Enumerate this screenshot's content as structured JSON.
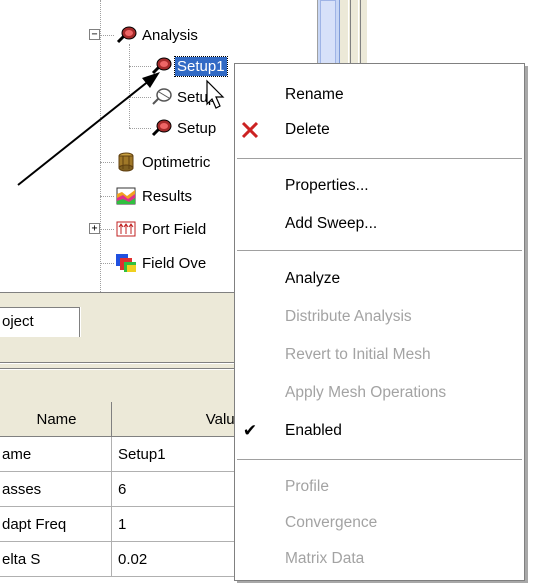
{
  "tree": {
    "nodes": [
      {
        "label": "Analysis",
        "icon": "analysis-icon"
      },
      {
        "label": "Setup1",
        "icon": "setup-icon",
        "selected": true
      },
      {
        "label": "Setup",
        "icon": "setup-disabled-icon"
      },
      {
        "label": "Setup",
        "icon": "setup-icon"
      },
      {
        "label": "Optimetric",
        "icon": "optimetrics-icon"
      },
      {
        "label": "Results",
        "icon": "results-icon"
      },
      {
        "label": "Port Field",
        "icon": "port-field-icon"
      },
      {
        "label": "Field Ove",
        "icon": "field-overlays-icon"
      }
    ],
    "expander_minus": "−",
    "expander_plus": "+"
  },
  "tabs": {
    "project_label": "oject"
  },
  "property_grid": {
    "headers": [
      "Name",
      "Value"
    ],
    "rows": [
      {
        "name": "ame",
        "value": "Setup1"
      },
      {
        "name": "asses",
        "value": "6"
      },
      {
        "name": "dapt Freq",
        "value": "1"
      },
      {
        "name": "elta S",
        "value": "0.02"
      }
    ]
  },
  "context_menu": {
    "items": [
      {
        "label": "Rename",
        "enabled": true
      },
      {
        "label": "Delete",
        "enabled": true,
        "icon": "delete-x-icon"
      },
      {
        "separator": true
      },
      {
        "label": "Properties...",
        "enabled": true
      },
      {
        "label": "Add Sweep...",
        "enabled": true
      },
      {
        "separator": true
      },
      {
        "label": "Analyze",
        "enabled": true
      },
      {
        "label": "Distribute Analysis",
        "enabled": false
      },
      {
        "label": "Revert to Initial Mesh",
        "enabled": false
      },
      {
        "label": "Apply Mesh Operations",
        "enabled": false
      },
      {
        "label": "Enabled",
        "enabled": true,
        "checked": true
      },
      {
        "separator": true
      },
      {
        "label": "Profile",
        "enabled": false
      },
      {
        "label": "Convergence",
        "enabled": false
      },
      {
        "label": "Matrix Data",
        "enabled": false
      }
    ],
    "delete_icon_glyph": "✕",
    "check_glyph": "✔"
  },
  "colors": {
    "selection": "#316ac5",
    "disabled_text": "#a3a3a3",
    "delete_icon": "#cc2222",
    "chrome": "#ece9d8"
  }
}
